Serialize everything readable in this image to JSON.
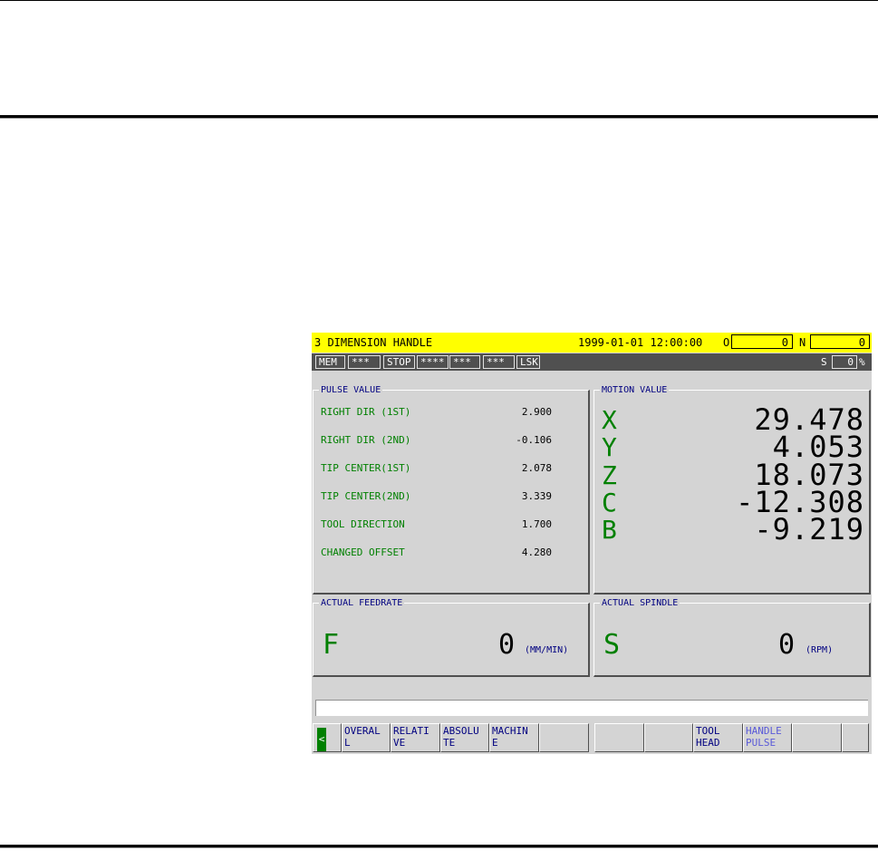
{
  "screen": {
    "title": "3 DIMENSION HANDLE",
    "datetime": "1999-01-01 12:00:00",
    "o_label": "O",
    "o_value": "0",
    "n_label": "N",
    "n_value": "0"
  },
  "status": {
    "cells": [
      "MEM",
      "***",
      "STOP",
      "****",
      "***",
      "***",
      "LSK"
    ],
    "s_label": "S",
    "s_value": "0",
    "percent": "%"
  },
  "pulse_value": {
    "title": "PULSE VALUE",
    "rows": [
      {
        "label": "RIGHT DIR (1ST)",
        "value": "2.900"
      },
      {
        "label": "RIGHT DIR (2ND)",
        "value": "-0.106"
      },
      {
        "label": "TIP CENTER(1ST)",
        "value": "2.078"
      },
      {
        "label": "TIP CENTER(2ND)",
        "value": "3.339"
      },
      {
        "label": "TOOL DIRECTION",
        "value": "1.700"
      },
      {
        "label": "CHANGED OFFSET",
        "value": "4.280"
      }
    ]
  },
  "motion_value": {
    "title": "MOTION VALUE",
    "axes": [
      {
        "axis": "X",
        "value": "29.478"
      },
      {
        "axis": "Y",
        "value": "4.053"
      },
      {
        "axis": "Z",
        "value": "18.073"
      },
      {
        "axis": "C",
        "value": "-12.308"
      },
      {
        "axis": "B",
        "value": "-9.219"
      }
    ]
  },
  "feedrate": {
    "title": "ACTUAL FEEDRATE",
    "letter": "F",
    "value": "0",
    "unit": "(MM/MIN)"
  },
  "spindle": {
    "title": "ACTUAL SPINDLE",
    "letter": "S",
    "value": "0",
    "unit": "(RPM)"
  },
  "softkeys": {
    "arrow": "<",
    "keys": [
      "OVERAL\nL",
      "RELATI\nVE",
      "ABSOLU\nTE",
      "MACHIN\nE",
      "",
      "",
      "",
      "TOOL\nHEAD",
      "HANDLE\nPULSE",
      "",
      ""
    ]
  }
}
